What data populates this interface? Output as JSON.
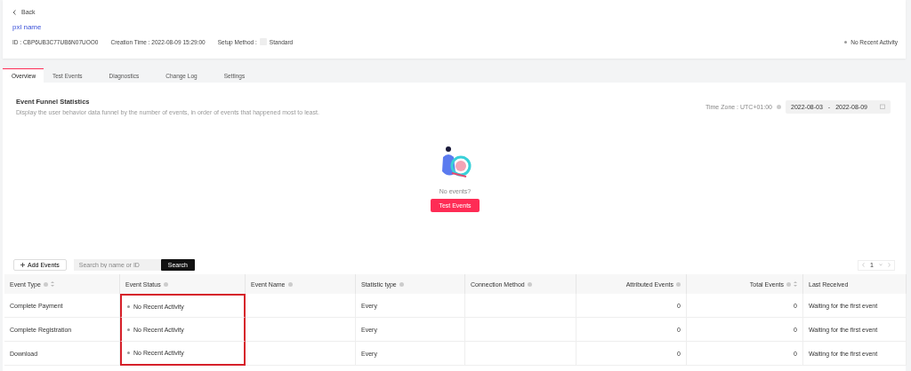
{
  "header": {
    "back": "Back",
    "pixel_name": "pxl name",
    "id": "ID : CBP6UB3C77UB6N07UOO0",
    "creation_time": "Creation Time : 2022-08-09 15:29:00",
    "setup_method_label": "Setup Method :",
    "setup_method": "Standard",
    "status": "No Recent Activity"
  },
  "tabs": [
    {
      "label": "Overview",
      "selected": true
    },
    {
      "label": "Test Events",
      "selected": false
    },
    {
      "label": "Diagnostics",
      "selected": false
    },
    {
      "label": "Change Log",
      "selected": false
    },
    {
      "label": "Settings",
      "selected": false
    }
  ],
  "funnel": {
    "title": "Event Funnel Statistics",
    "subtitle": "Display the user behavior data funnel by the number of events, in order of events that happened most to least.",
    "time_zone": "Time Zone : UTC+01:00",
    "date_from": "2022-08-03",
    "date_separator": "-",
    "date_to": "2022-08-09",
    "empty_text": "No events?",
    "test_button": "Test Events"
  },
  "toolbar": {
    "add_button": "Add Events",
    "search_placeholder": "Search by name or ID",
    "search_button": "Search",
    "page": "1"
  },
  "table": {
    "columns": [
      {
        "label": "Event Type",
        "info": true,
        "sortable": true,
        "numeric": false,
        "highlighted": false
      },
      {
        "label": "Event Status",
        "info": true,
        "sortable": false,
        "numeric": false,
        "highlighted": true
      },
      {
        "label": "Event Name",
        "info": true,
        "sortable": false,
        "numeric": false,
        "highlighted": false
      },
      {
        "label": "Statistic type",
        "info": true,
        "sortable": false,
        "numeric": false,
        "highlighted": false
      },
      {
        "label": "Connection Method",
        "info": true,
        "sortable": false,
        "numeric": false,
        "highlighted": false
      },
      {
        "label": "Attributed Events",
        "info": true,
        "sortable": false,
        "numeric": true,
        "highlighted": false
      },
      {
        "label": "Total Events",
        "info": true,
        "sortable": true,
        "numeric": true,
        "highlighted": false
      },
      {
        "label": "Last Received",
        "info": false,
        "sortable": false,
        "numeric": false,
        "highlighted": false
      }
    ],
    "rows": [
      [
        "Complete Payment",
        "No Recent Activity",
        "",
        "Every",
        "",
        "0",
        "0",
        "Waiting for the first event"
      ],
      [
        "Complete Registration",
        "No Recent Activity",
        "",
        "Every",
        "",
        "0",
        "0",
        "Waiting for the first event"
      ],
      [
        "Download",
        "No Recent Activity",
        "",
        "Every",
        "",
        "0",
        "0",
        "Waiting for the first event"
      ]
    ]
  }
}
